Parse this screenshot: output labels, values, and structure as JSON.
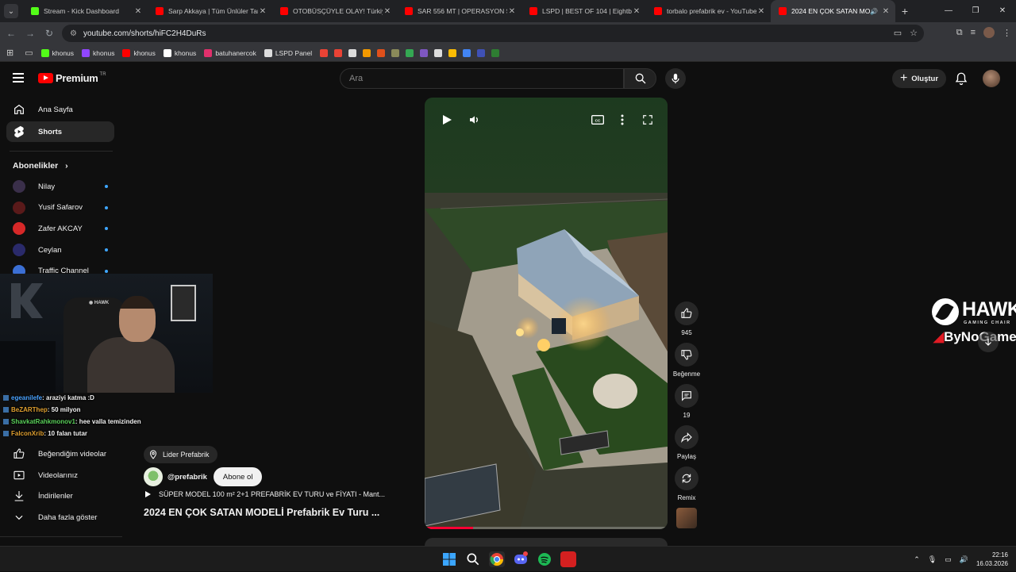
{
  "browser": {
    "tabs": [
      {
        "title": "Stream - Kick Dashboard",
        "color": "#53fc18",
        "active": false
      },
      {
        "title": "Sarp Akkaya | Tüm Ünlüler Tan",
        "color": "#ff0000",
        "active": false
      },
      {
        "title": "OTOBÜSÇÜYLE OLAY! Türkiye'd",
        "color": "#ff0000",
        "active": false
      },
      {
        "title": "SAR 556 MT | OPERASYON SA",
        "color": "#ff0000",
        "active": false
      },
      {
        "title": "LSPD | BEST OF 104 | Eightbom",
        "color": "#ff0000",
        "active": false
      },
      {
        "title": "torbalo prefabrik ev - YouTube",
        "color": "#ff0000",
        "active": false
      },
      {
        "title": "2024 EN ÇOK SATAN MODE",
        "color": "#ff0000",
        "active": true
      }
    ],
    "url": "youtube.com/shorts/hiFC2H4DuRs",
    "bookmarks": [
      {
        "label": "khonus",
        "color": "#53fc18"
      },
      {
        "label": "khonus",
        "color": "#9146ff"
      },
      {
        "label": "khonus",
        "color": "#ff0000"
      },
      {
        "label": "khonus",
        "color": "#ffffff"
      },
      {
        "label": "batuhanercok",
        "color": "#e1306c"
      },
      {
        "label": "LSPD Panel",
        "color": "#dddddd"
      }
    ],
    "bookmark_icons": [
      "#ea4335",
      "#ea4335",
      "#dddddd",
      "#f29900",
      "#e0501b",
      "#8a8a5a",
      "#34a853",
      "#7e57c2",
      "#dddddd",
      "#fbbc04",
      "#4285f4",
      "#3f51b5",
      "#2e7d32"
    ]
  },
  "youtube": {
    "brand": "Premium",
    "brand_sup": "TR",
    "search_placeholder": "Ara",
    "create_label": "Oluştur",
    "sidebar": {
      "home": "Ana Sayfa",
      "shorts": "Shorts",
      "subscriptions_heading": "Abonelikler",
      "subscriptions": [
        {
          "name": "Nilay",
          "color": "#3a2f4a"
        },
        {
          "name": "Yusif Safarov",
          "color": "#5a1a1a"
        },
        {
          "name": "Zafer AKCAY",
          "color": "#d62828"
        },
        {
          "name": "Ceylan",
          "color": "#2a2a6a"
        },
        {
          "name": "Traffic Channel",
          "color": "#3b6fd4"
        }
      ],
      "liked_videos": "Beğendiğim videolar",
      "your_videos": "Videolarınız",
      "downloads": "İndirilenler",
      "show_more": "Daha fazla göster"
    },
    "short": {
      "location": "Lider Prefabrik",
      "channel": "@prefabrik",
      "subscribe": "Abone ol",
      "playlist": "SÜPER MODEL 100 m² 2+1 PREFABRİK EV TURU ve FİYATI - Mant...",
      "title": "2024 EN ÇOK SATAN MODELİ Prefabrik Ev Turu ...",
      "likes": "945",
      "dislike_label": "Beğenme",
      "comments": "19",
      "share_label": "Paylaş",
      "remix_label": "Remix",
      "progress": 0.2
    }
  },
  "stream_overlay": {
    "chat": [
      {
        "user": "egeanilefe",
        "msg": ": araziyi katma :D",
        "color": "#4aa3ff"
      },
      {
        "user": "BeZARThep",
        "msg": ": 50 milyon",
        "color": "#e0a030"
      },
      {
        "user": "ShavkatRahkmonov1",
        "msg": ": hee valla temizinden",
        "color": "#5ad15a"
      },
      {
        "user": "FalconXrib",
        "msg": ": 10 falan tutar",
        "color": "#e0a030"
      }
    ],
    "sponsor_word": "HAWK",
    "sponsor_sub": "GAMING CHAIR",
    "sponsor_by_prefix": "",
    "sponsor_by": "ByNoGame"
  },
  "taskbar": {
    "time": "22:16",
    "date": "16.03.2026"
  }
}
